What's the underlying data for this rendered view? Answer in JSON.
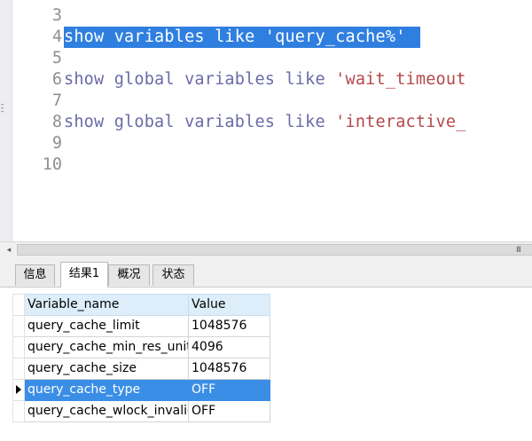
{
  "editor": {
    "lines": [
      {
        "num": "3",
        "parts": []
      },
      {
        "num": "4",
        "selected": true,
        "parts": [
          {
            "t": "show ",
            "c": "kw"
          },
          {
            "t": "variables ",
            "c": "kw"
          },
          {
            "t": "like ",
            "c": "kw"
          },
          {
            "t": "'query_cache%'",
            "c": "str"
          }
        ]
      },
      {
        "num": "5",
        "parts": []
      },
      {
        "num": "6",
        "parts": [
          {
            "t": "show ",
            "c": "kw"
          },
          {
            "t": "global ",
            "c": "kw"
          },
          {
            "t": "variables ",
            "c": "kw"
          },
          {
            "t": "like ",
            "c": "kw"
          },
          {
            "t": "'wait_timeout",
            "c": "str"
          }
        ]
      },
      {
        "num": "7",
        "parts": []
      },
      {
        "num": "8",
        "parts": [
          {
            "t": "show ",
            "c": "kw"
          },
          {
            "t": "global ",
            "c": "kw"
          },
          {
            "t": "variables ",
            "c": "kw"
          },
          {
            "t": "like ",
            "c": "kw"
          },
          {
            "t": "'interactive_",
            "c": "str"
          }
        ]
      },
      {
        "num": "9",
        "parts": []
      },
      {
        "num": "10",
        "parts": []
      }
    ]
  },
  "scrollbar": {
    "left_arrow": "◂",
    "grip": "III"
  },
  "tabs": [
    {
      "label": "信息",
      "active": false
    },
    {
      "label": "结果1",
      "active": true
    },
    {
      "label": "概况",
      "active": false
    },
    {
      "label": "状态",
      "active": false
    }
  ],
  "results": {
    "columns": [
      "Variable_name",
      "Value"
    ],
    "rows": [
      [
        "query_cache_limit",
        "1048576"
      ],
      [
        "query_cache_min_res_unit",
        "4096"
      ],
      [
        "query_cache_size",
        "1048576"
      ],
      [
        "query_cache_type",
        "OFF"
      ],
      [
        "query_cache_wlock_invalid",
        "OFF"
      ]
    ],
    "selected_row": 3
  },
  "colors": {
    "selection": "#2f7fe0",
    "row_selected": "#3b8ee6",
    "header_bg": "#ddeefa"
  }
}
